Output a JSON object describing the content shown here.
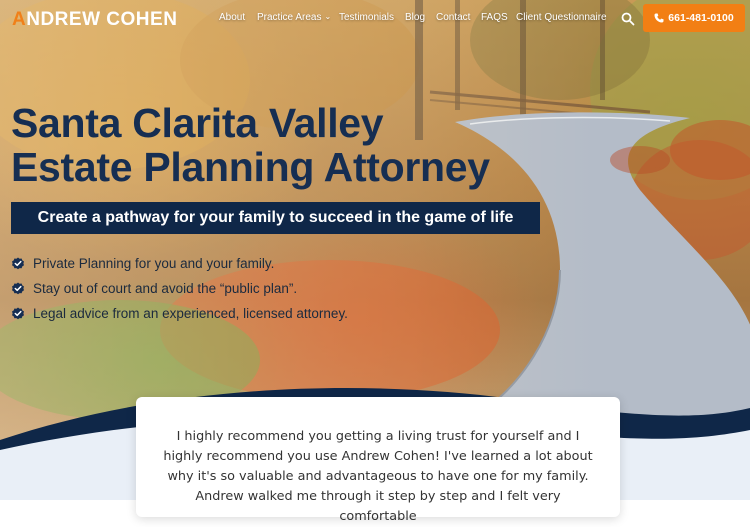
{
  "brand": {
    "name_first": "ANDREW",
    "name_last": "COHEN",
    "accent_color": "#f08019",
    "navy": "#0f2748"
  },
  "nav": {
    "items": [
      {
        "label": "About"
      },
      {
        "label": "Practice Areas",
        "has_dropdown": true
      },
      {
        "label": "Testimonials"
      },
      {
        "label": "Blog"
      },
      {
        "label": "Contact"
      },
      {
        "label": "FAQS"
      },
      {
        "label": "Client Questionnaire"
      }
    ],
    "search_icon": "search-icon",
    "phone": "661-481-0100",
    "phone_icon": "phone-icon"
  },
  "hero": {
    "title_line1": "Santa Clarita Valley",
    "title_line2": "Estate Planning Attorney",
    "tagline": "Create a pathway for your family to succeed in the game of life",
    "bullets": [
      "Private Planning for you and your family.",
      "Stay out of court and avoid the “public plan”.",
      "Legal advice from an experienced, licensed attorney."
    ],
    "bullet_icon": "check-badge-icon"
  },
  "testimonial": {
    "text": "I highly recommend you getting a living trust for yourself and I highly recommend you use Andrew Cohen! I've learned a lot about why it's so valuable and advantageous to have one for my family. Andrew walked me through it step by step and I felt very comfortable"
  }
}
